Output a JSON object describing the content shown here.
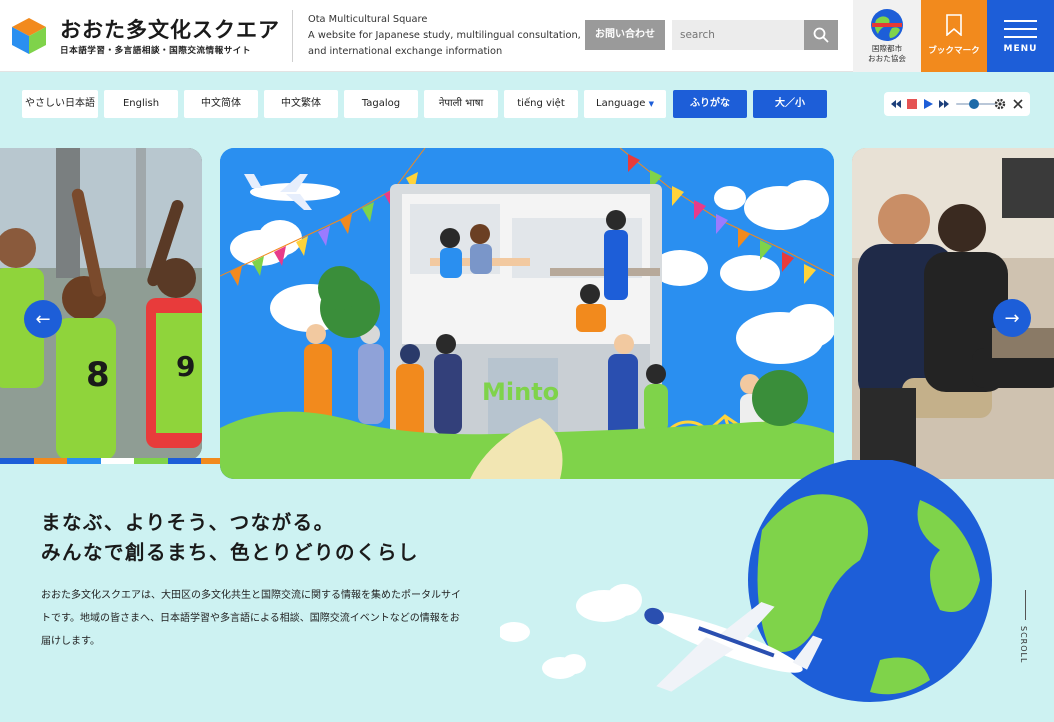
{
  "header": {
    "logo_title": "おおた多文化スクエア",
    "logo_subtitle": "日本語学習・多言語相談・国際交流情報サイト",
    "site_name": "Ota Multicultural Square",
    "site_desc_1": "A website for Japanese study, multilingual consultation,",
    "site_desc_2": "and international exchange information",
    "contact_label": "お問い合わせ",
    "search_placeholder": "search",
    "intl_label_1": "国際都市",
    "intl_label_2": "おおた協会",
    "bookmark_label": "ブックマーク",
    "menu_label": "MENU"
  },
  "languages": {
    "items": [
      "やさしい日本語",
      "English",
      "中文简体",
      "中文繁体",
      "Tagalog",
      "नेपाली भाषा",
      "tiếng việt",
      "Language"
    ],
    "furigana_label": "ふりがな",
    "size_label": "大／小"
  },
  "audio": {
    "icons": [
      "rewind-icon",
      "stop-icon",
      "play-icon",
      "fast-forward-icon",
      "volume-slider",
      "gear-icon",
      "close-icon"
    ]
  },
  "hero": {
    "sign_text": "Minto",
    "prev_icon": "arrow-left-icon",
    "next_icon": "arrow-right-icon",
    "colors": {
      "blue": "#1d5ed8",
      "orange": "#f28a1d",
      "sky": "#2a8ff0",
      "green": "#7fd34a",
      "bg": "#cdf2f2"
    }
  },
  "main": {
    "headline_1": "まなぶ、よりそう、つながる。",
    "headline_2": "みんなで創るまち、色とりどりのくらし",
    "intro": "おおた多文化スクエアは、大田区の多文化共生と国際交流に関する情報を集めたポータルサイトです。地域の皆さまへ、日本語学習や多言語による相談、国際交流イベントなどの情報をお届けします。",
    "scroll_label": "SCROLL"
  }
}
